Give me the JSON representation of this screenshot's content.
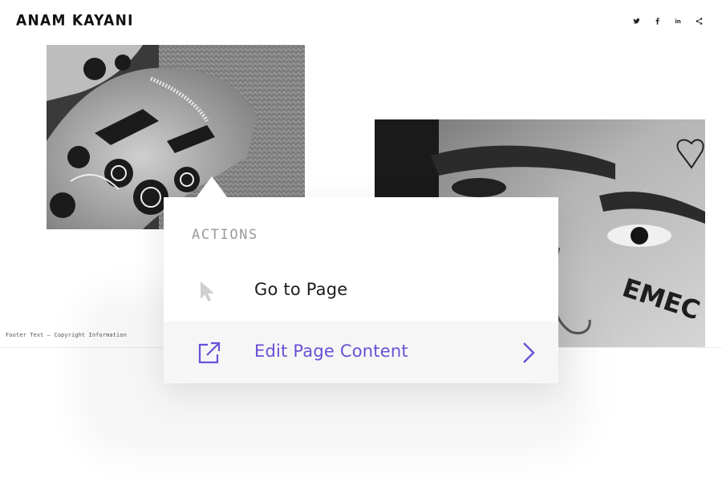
{
  "site": {
    "title": "ANAM KAYANI"
  },
  "social": {
    "icons": [
      "twitter-icon",
      "facebook-icon",
      "linkedin-icon",
      "share-icon"
    ],
    "linkedin_label": "in"
  },
  "footer": {
    "text": "Footer Text — Copyright Information"
  },
  "popup": {
    "heading": "ACTIONS",
    "items": [
      {
        "label": "Go to Page",
        "icon": "cursor-pointer-icon"
      },
      {
        "label": "Edit Page Content",
        "icon": "external-link-icon",
        "trailing_icon": "chevron-right-icon"
      }
    ]
  },
  "images": [
    {
      "name": "tattoo-arm-photo"
    },
    {
      "name": "face-photo",
      "visible_text": "EMEC"
    }
  ],
  "colors": {
    "accent": "#6a4fd6",
    "muted_icon": "#cfcfcf",
    "heading": "#9a9a9a",
    "text": "#1d1d1d"
  }
}
